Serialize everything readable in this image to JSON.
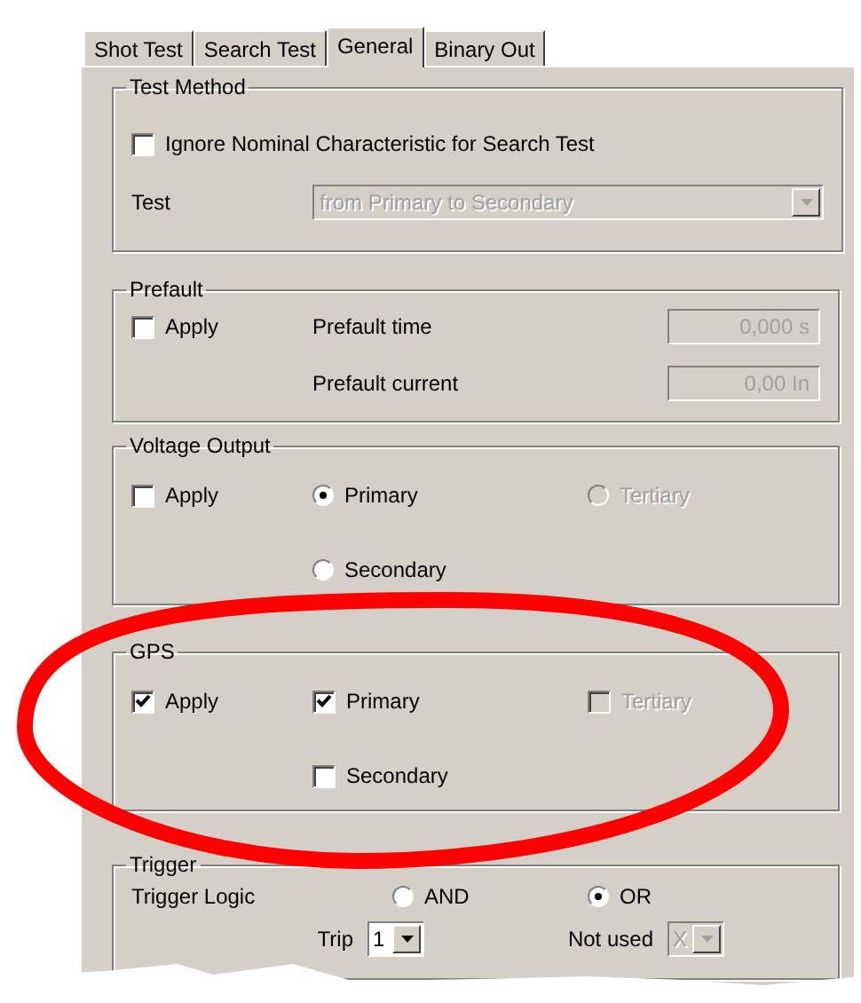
{
  "tabs": [
    {
      "label": "Shot Test",
      "selected": false
    },
    {
      "label": "Search Test",
      "selected": false
    },
    {
      "label": "General",
      "selected": true
    },
    {
      "label": "Binary Out",
      "selected": false
    }
  ],
  "test_method": {
    "title": "Test Method",
    "ignore_nominal": {
      "label": "Ignore Nominal Characteristic for Search Test",
      "checked": false
    },
    "test_label": "Test",
    "test_value": "from Primary to Secondary",
    "test_disabled": true
  },
  "prefault": {
    "title": "Prefault",
    "apply": {
      "label": "Apply",
      "checked": false
    },
    "fields": [
      {
        "label": "Prefault time",
        "value": "0,000 s",
        "disabled": true
      },
      {
        "label": "Prefault current",
        "value": "0,00 In",
        "disabled": true
      }
    ]
  },
  "voltage_output": {
    "title": "Voltage Output",
    "apply": {
      "label": "Apply",
      "checked": false
    },
    "options": [
      {
        "label": "Primary",
        "selected": true,
        "disabled": false
      },
      {
        "label": "Tertiary",
        "selected": false,
        "disabled": true
      },
      {
        "label": "Secondary",
        "selected": false,
        "disabled": false
      }
    ]
  },
  "gps": {
    "title": "GPS",
    "apply": {
      "label": "Apply",
      "checked": true
    },
    "options": [
      {
        "label": "Primary",
        "checked": true,
        "disabled": false
      },
      {
        "label": "Tertiary",
        "checked": false,
        "disabled": true
      },
      {
        "label": "Secondary",
        "checked": false,
        "disabled": false
      }
    ]
  },
  "trigger_condition": {
    "title": "Trigger",
    "logic_label": "Trigger Logic",
    "logic_options": [
      {
        "label": "AND",
        "selected": false
      },
      {
        "label": "OR",
        "selected": true
      }
    ],
    "inputs": [
      {
        "label": "Trip",
        "value": "1",
        "disabled": false
      },
      {
        "label": "Not used",
        "value": "X",
        "disabled": true
      }
    ]
  }
}
